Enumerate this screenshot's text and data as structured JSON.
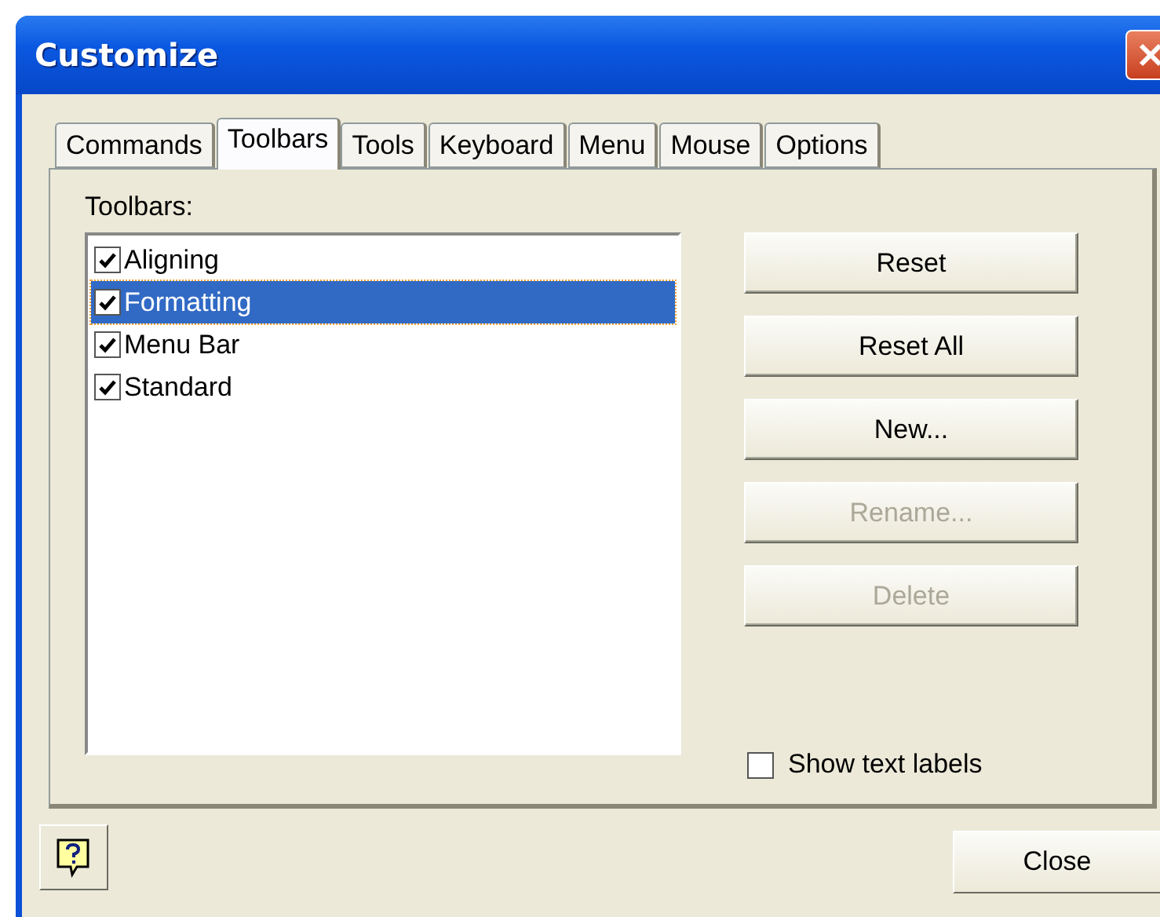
{
  "window": {
    "title": "Customize"
  },
  "tabs": [
    {
      "label": "Commands",
      "selected": false
    },
    {
      "label": "Toolbars",
      "selected": true
    },
    {
      "label": "Tools",
      "selected": false
    },
    {
      "label": "Keyboard",
      "selected": false
    },
    {
      "label": "Menu",
      "selected": false
    },
    {
      "label": "Mouse",
      "selected": false
    },
    {
      "label": "Options",
      "selected": false
    }
  ],
  "toolbars_label": {
    "text": "Toolbars:"
  },
  "toolbars": [
    {
      "label": "Aligning",
      "checked": true,
      "selected": false
    },
    {
      "label": "Formatting",
      "checked": true,
      "selected": true
    },
    {
      "label": "Menu Bar",
      "checked": true,
      "selected": false
    },
    {
      "label": "Standard",
      "checked": true,
      "selected": false
    }
  ],
  "buttons": [
    {
      "label": "Reset",
      "disabled": false
    },
    {
      "label": "Reset All",
      "disabled": false
    },
    {
      "label": "New...",
      "disabled": false
    },
    {
      "label": "Rename...",
      "disabled": true
    },
    {
      "label": "Delete",
      "disabled": true
    }
  ],
  "show_text_labels": {
    "label": "Show text labels",
    "checked": false
  },
  "close_button": {
    "label": "Close"
  }
}
